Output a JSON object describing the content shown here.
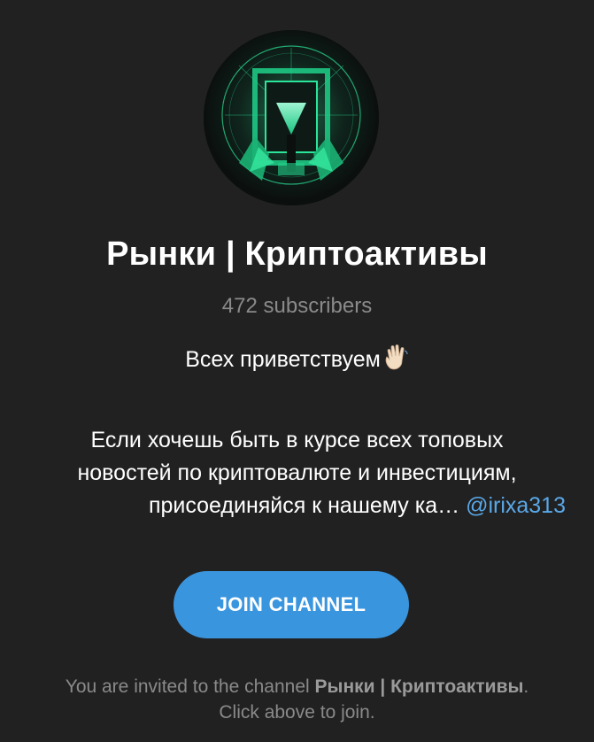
{
  "channel": {
    "title": "Рынки | Криптоактивы",
    "subscribers": "472 subscribers",
    "avatar_icon": "crypto-channel-avatar-icon",
    "accent_color": "#2be59a"
  },
  "description": {
    "greeting": "Всех приветствуем",
    "greeting_icon": "waving-hand-icon",
    "line1": "Если хочешь быть в курсе всех топовых",
    "line2": "новостей по криптовалюте и инвестициям,",
    "line3": "присоединяйся к нашему ка…",
    "mention": "@irixa313",
    "mention_color": "#5aa8e8"
  },
  "join_button": {
    "label": "JOIN CHANNEL",
    "color": "#3a95df"
  },
  "footer": {
    "prefix": "You are invited to the channel ",
    "channel_name": "Рынки | Криптоактивы",
    "suffix": ".",
    "line2": "Click above to join."
  }
}
